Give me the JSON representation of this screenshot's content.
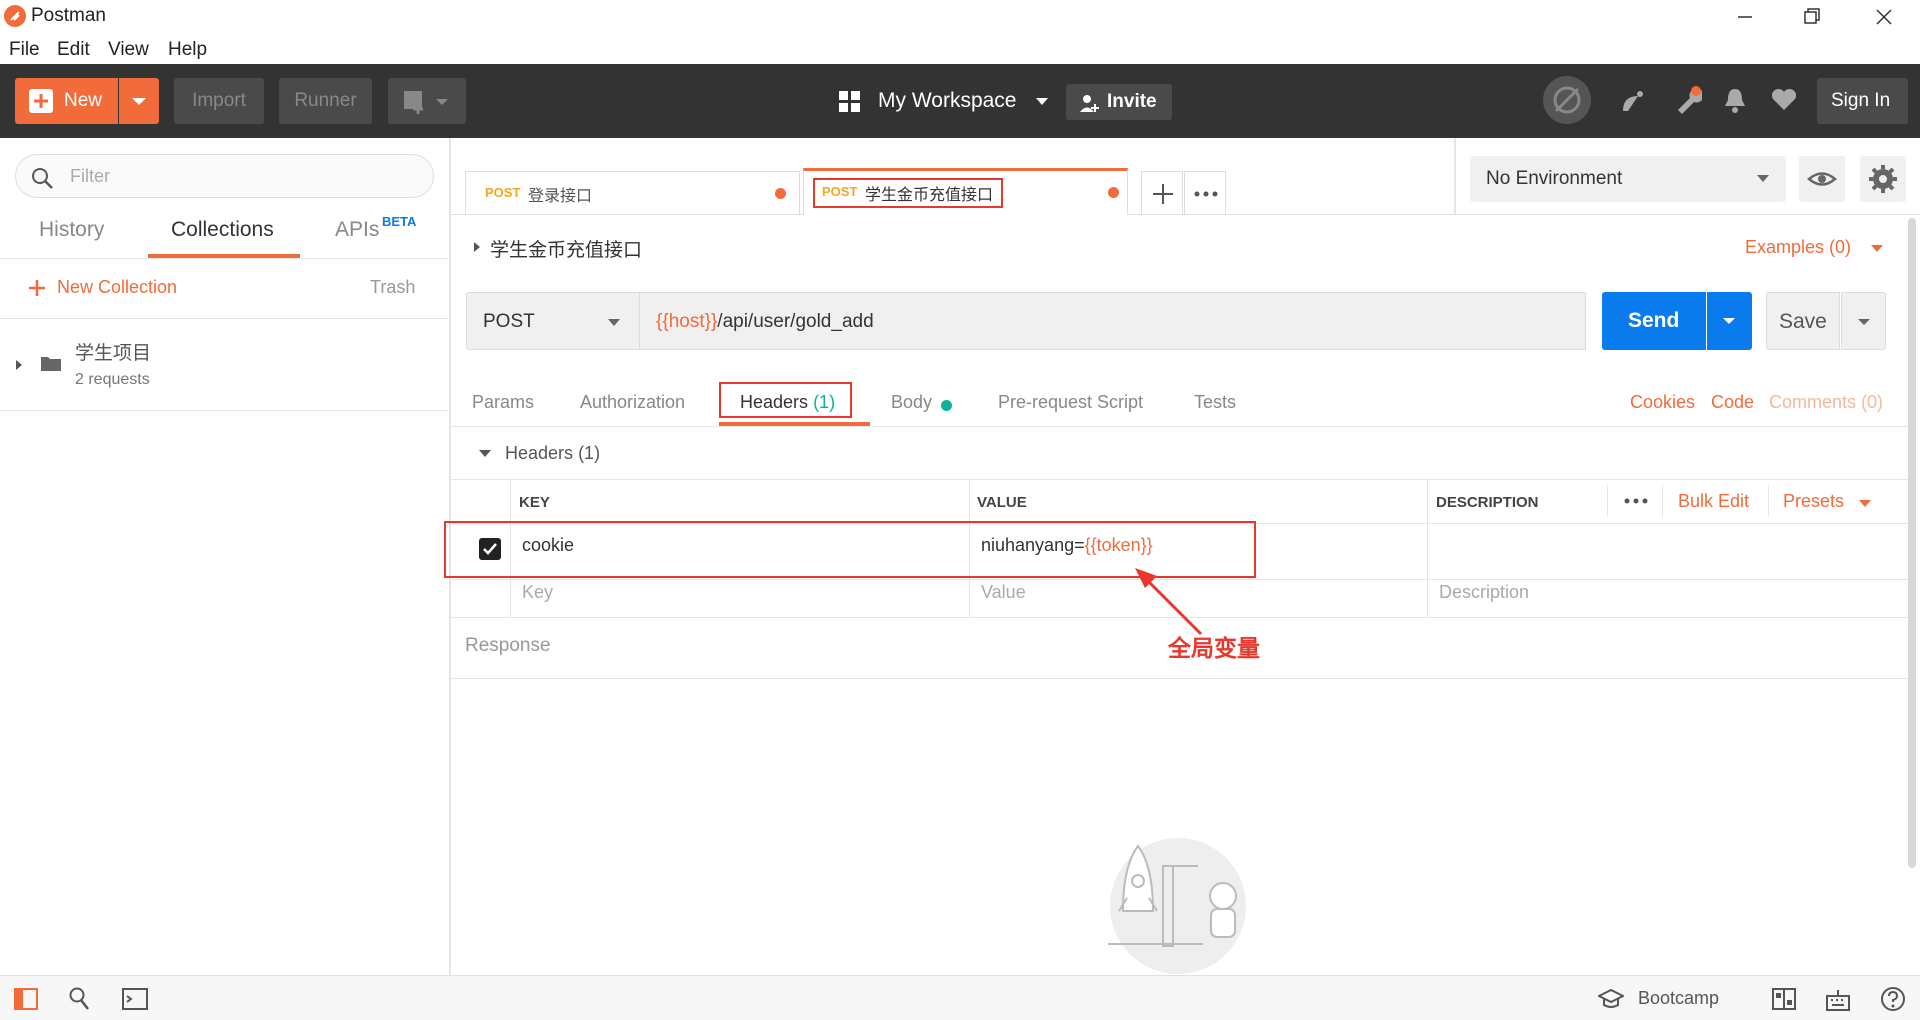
{
  "window": {
    "app_title": "Postman"
  },
  "menu": [
    "File",
    "Edit",
    "View",
    "Help"
  ],
  "header": {
    "new_label": "New",
    "import_label": "Import",
    "runner_label": "Runner",
    "workspace_label": "My Workspace",
    "invite_label": "Invite",
    "signin_label": "Sign In"
  },
  "sidebar": {
    "filter_placeholder": "Filter",
    "tabs": {
      "history": "History",
      "collections": "Collections",
      "apis": "APIs",
      "beta": "BETA"
    },
    "new_collection": "New Collection",
    "trash": "Trash",
    "collection": {
      "name": "学生项目",
      "meta": "2 requests"
    }
  },
  "tabs": [
    {
      "method": "POST",
      "name": "登录接口"
    },
    {
      "method": "POST",
      "name": "学生金币充值接口"
    }
  ],
  "environment": {
    "selected": "No Environment"
  },
  "request": {
    "title": "学生金币充值接口",
    "examples": "Examples (0)",
    "method": "POST",
    "url_var": "{{host}}",
    "url_path": "/api/user/gold_add",
    "send_label": "Send",
    "save_label": "Save"
  },
  "req_tabs": {
    "params": "Params",
    "authorization": "Authorization",
    "headers": "Headers",
    "headers_count": "(1)",
    "body": "Body",
    "prerequest": "Pre-request Script",
    "tests": "Tests",
    "cookies": "Cookies",
    "code": "Code",
    "comments": "Comments (0)"
  },
  "headers_section": {
    "title": "Headers",
    "count": "(1)",
    "columns": {
      "key": "KEY",
      "value": "VALUE",
      "description": "DESCRIPTION"
    },
    "bulk_edit": "Bulk Edit",
    "presets": "Presets",
    "row": {
      "key": "cookie",
      "value_prefix": "niuhanyang=",
      "value_var": "{{token}}"
    },
    "placeholders": {
      "key": "Key",
      "value": "Value",
      "description": "Description"
    }
  },
  "annotation": "全局变量",
  "response_label": "Response",
  "statusbar": {
    "bootcamp": "Bootcamp"
  },
  "colors": {
    "accent": "#f26b3a",
    "send_blue": "#097bed",
    "header_bg": "#333333",
    "annotation_red": "#e8372c"
  }
}
